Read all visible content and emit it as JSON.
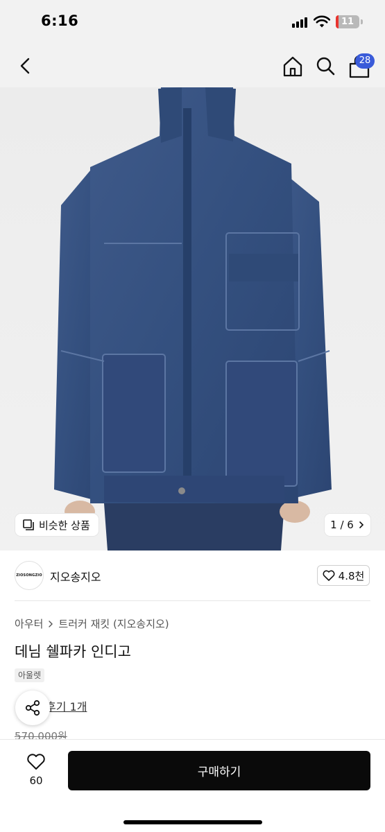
{
  "status_bar": {
    "time": "6:16",
    "battery": "11",
    "battery_level": 0.11
  },
  "header": {
    "cart_count": "28",
    "icons": [
      "back-icon",
      "home-icon",
      "search-icon",
      "bag-icon"
    ]
  },
  "gallery": {
    "similar_label": "비슷한 상품",
    "page_indicator": "1 / 6"
  },
  "store": {
    "logo_text": "ZIOSONGZIO",
    "name": "지오송지오",
    "likes": "4.8천"
  },
  "product": {
    "breadcrumb": {
      "category": "아우터",
      "subcategory": "트러커 재킷 (지오송지오)"
    },
    "title": "데님 쉘파카 인디고",
    "tag": "아울렛",
    "review_link": "후기 1개",
    "original_price": "570,000원"
  },
  "bottom_bar": {
    "like_count": "60",
    "buy_label": "구매하기"
  },
  "colors": {
    "badge": "#3a5bd9",
    "denim": "#3a5583",
    "buy_button": "#0a0a0a"
  }
}
